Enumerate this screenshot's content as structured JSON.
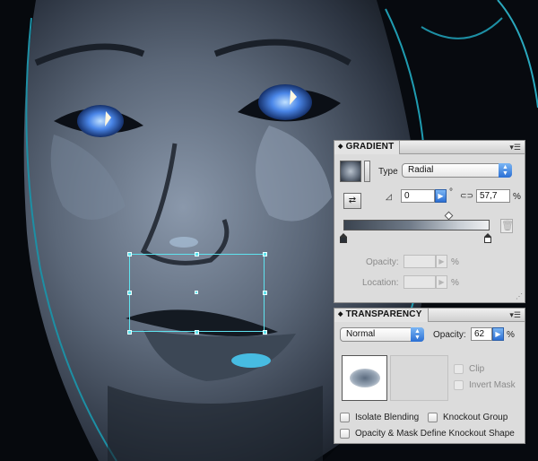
{
  "gradient_panel": {
    "tab_title": "GRADIENT",
    "type_label": "Type",
    "type_value": "Radial",
    "angle_value": "0",
    "angle_unit": "°",
    "aspect_value": "57,7",
    "aspect_unit": "%",
    "opacity_label": "Opacity:",
    "opacity_unit": "%",
    "location_label": "Location:",
    "location_unit": "%",
    "stop_colors": [
      "#2a2f36",
      "#ffffff"
    ]
  },
  "transparency_panel": {
    "tab_title": "TRANSPARENCY",
    "blend_mode": "Normal",
    "opacity_label": "Opacity:",
    "opacity_value": "62",
    "opacity_unit": "%",
    "clip_label": "Clip",
    "invert_mask_label": "Invert Mask",
    "isolate_blending_label": "Isolate Blending",
    "knockout_group_label": "Knockout Group",
    "opacity_mask_label": "Opacity & Mask Define Knockout Shape"
  },
  "colors": {
    "selection": "#5fe3ef",
    "accent_blue": "#2b6fd4",
    "panel_bg": "#dcdcdc"
  },
  "icons": [
    "gradient-preview-icon",
    "reverse-gradient-icon",
    "angle-icon",
    "aspect-ratio-icon",
    "delete-stop-icon",
    "panel-menu-icon"
  ]
}
